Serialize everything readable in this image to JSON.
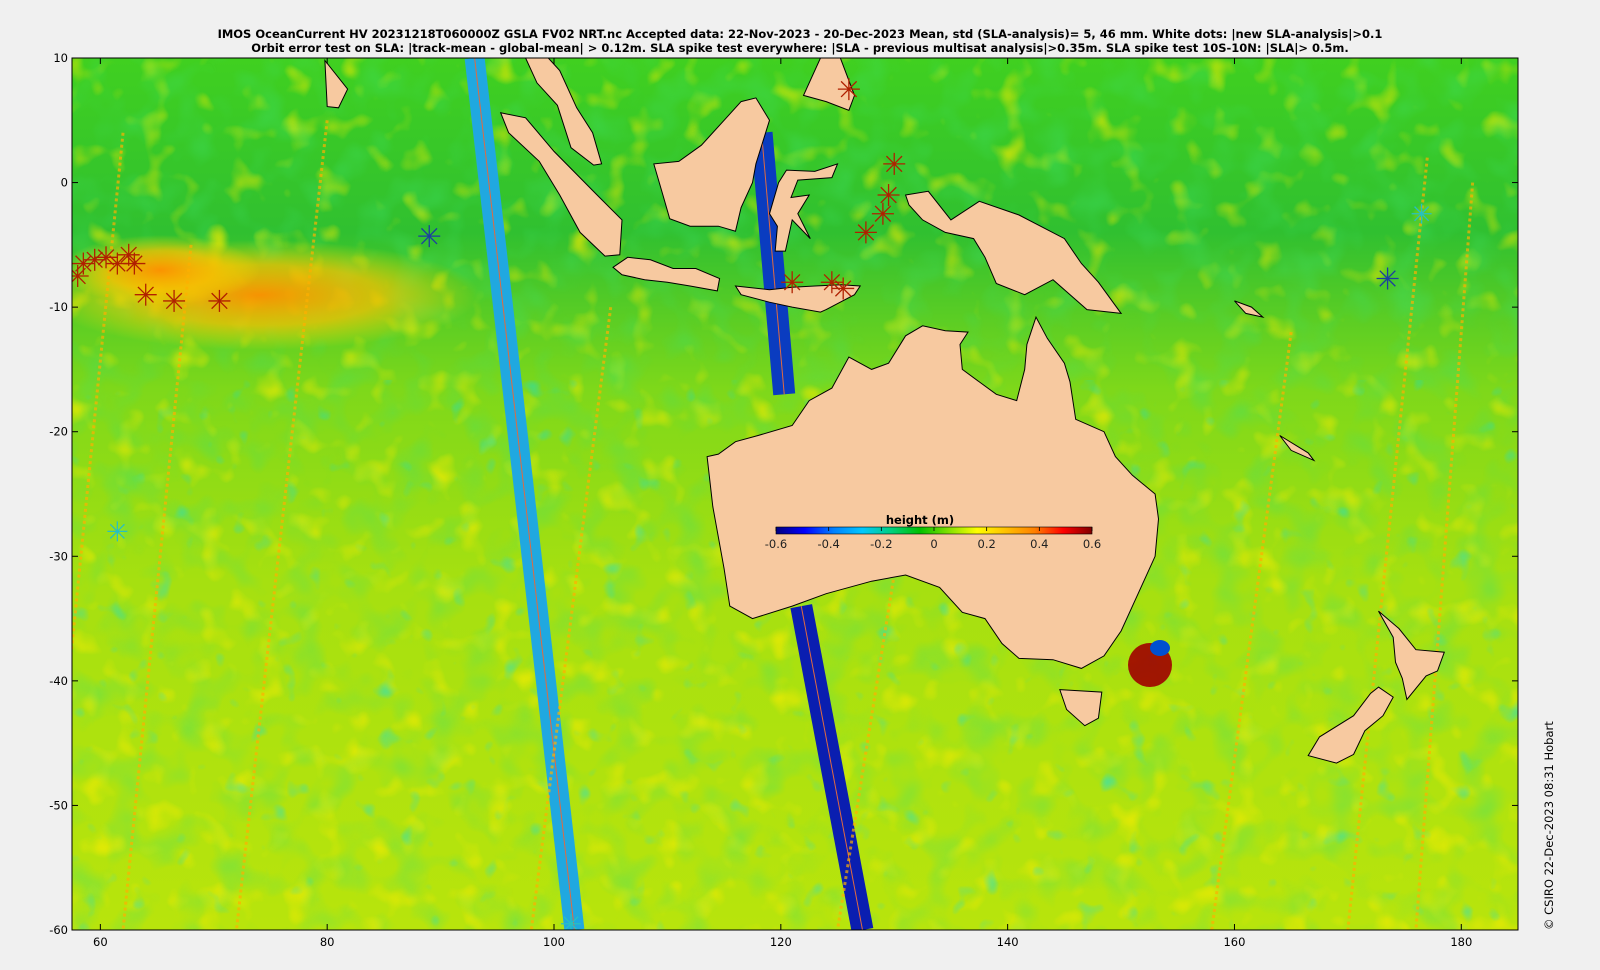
{
  "title": {
    "line1": "IMOS OceanCurrent HV 20231218T060000Z GSLA FV02 NRT.nc  Accepted data: 22-Nov-2023 - 20-Dec-2023 Mean, std (SLA-analysis)= 5, 46 mm. White dots: |new SLA-analysis|>0.1",
    "line2": "Orbit error test on SLA: |track-mean - global-mean| > 0.12m.  SLA spike test everywhere: |SLA - previous multisat analysis|>0.35m. SLA spike test 10S-10N: |SLA|> 0.5m."
  },
  "map": {
    "lon_range": [
      57.5,
      185
    ],
    "lat_range": [
      -60,
      10
    ],
    "x_ticks": [
      60,
      80,
      100,
      120,
      140,
      160,
      180
    ],
    "y_ticks": [
      10,
      0,
      -10,
      -20,
      -30,
      -40,
      -50,
      -60
    ],
    "land_color": "#f7c9a0",
    "coastline_color": "#000000"
  },
  "colorbar": {
    "title": "height (m)",
    "range": [
      -0.6,
      0.6
    ],
    "ticks": [
      "-0.6",
      "-0.4",
      "-0.2",
      "0",
      "0.2",
      "0.4",
      "0.6"
    ],
    "colormap": [
      "#00007f",
      "#0000ff",
      "#0080ff",
      "#00c8ff",
      "#00d080",
      "#00c000",
      "#80e000",
      "#ffff00",
      "#ffc000",
      "#ff8000",
      "#ff0000",
      "#800000"
    ]
  },
  "credit": "© CSIRO 22-Dec-2023 08:31 Hobart"
}
